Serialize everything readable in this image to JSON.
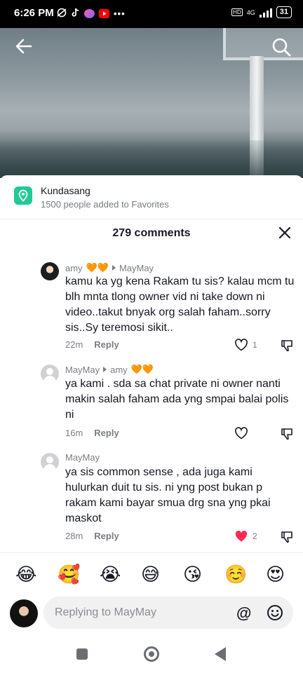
{
  "status_bar": {
    "time": "6:26 PM",
    "network": "4G",
    "battery": "31"
  },
  "video": {
    "back_icon": "arrow-left-icon",
    "search_icon": "search-icon"
  },
  "location": {
    "icon": "location-pin-icon",
    "color": "#20c997",
    "name": "Kundasang",
    "subtitle": "1500 people added to Favorites"
  },
  "comments_header": {
    "title": "279 comments",
    "close_icon": "close-icon"
  },
  "comments": [
    {
      "author": "amy",
      "author_hearts": "🧡🧡",
      "reply_to": "MayMay",
      "reply_to_hearts": "",
      "text": "kamu ka yg kena Rakam tu sis? kalau mcm tu blh mnta tlong owner vid ni take down ni video..takut bnyak org salah faham..sorry sis..Sy teremosi sikit..",
      "time": "22m",
      "reply_label": "Reply",
      "likes": "1",
      "liked": false
    },
    {
      "author": "MayMay",
      "author_hearts": "",
      "reply_to": "amy",
      "reply_to_hearts": "🧡🧡",
      "text": "ya kami . sda sa chat private ni owner nanti makin salah faham ada yng smpai balai polis ni",
      "time": "16m",
      "reply_label": "Reply",
      "likes": "",
      "liked": false
    },
    {
      "author": "MayMay",
      "author_hearts": "",
      "reply_to": "",
      "reply_to_hearts": "",
      "text": "ya sis common sense , ada juga kami hulurkan duit tu sis. ni yng post bukan p rakam kami bayar smua drg sna yng pkai maskot",
      "time": "28m",
      "reply_label": "Reply",
      "likes": "2",
      "liked": true,
      "like_color": "#fe2c55"
    }
  ],
  "emoji_bar": [
    "😂",
    "🥰",
    "😭",
    "😅",
    "😘",
    "☺️",
    "😍"
  ],
  "reply_box": {
    "placeholder": "Replying to MayMay",
    "mention_symbol": "@",
    "emoji_icon": "smiley-icon"
  }
}
